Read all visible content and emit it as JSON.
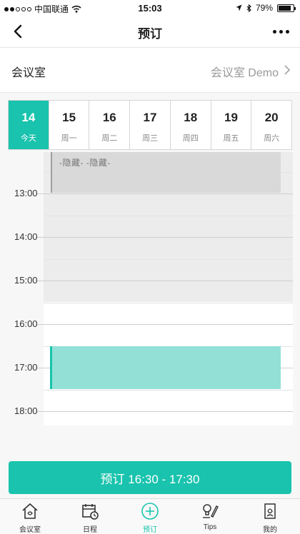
{
  "status_bar": {
    "carrier": "中国联通",
    "time": "15:03",
    "battery": "79%"
  },
  "nav": {
    "title": "预订"
  },
  "room": {
    "label": "会议室",
    "value": "会议室 Demo"
  },
  "dates": [
    {
      "num": "14",
      "weekday": "今天",
      "active": true
    },
    {
      "num": "15",
      "weekday": "周一"
    },
    {
      "num": "16",
      "weekday": "周二"
    },
    {
      "num": "17",
      "weekday": "周三"
    },
    {
      "num": "18",
      "weekday": "周四"
    },
    {
      "num": "19",
      "weekday": "周五"
    },
    {
      "num": "20",
      "weekday": "周六"
    }
  ],
  "schedule": {
    "times": [
      "13:00",
      "14:00",
      "15:00",
      "16:00",
      "17:00",
      "18:00"
    ],
    "hidden_event_label": "-隐藏- -隐藏-"
  },
  "book_button": {
    "label": "预订 16:30 - 17:30"
  },
  "tabs": [
    {
      "label": "会议室",
      "icon": "house-icon"
    },
    {
      "label": "日程",
      "icon": "calendar-icon"
    },
    {
      "label": "预订",
      "icon": "plus-circle-icon",
      "active": true
    },
    {
      "label": "Tips",
      "icon": "tips-icon"
    },
    {
      "label": "我的",
      "icon": "profile-icon"
    }
  ],
  "colors": {
    "accent": "#19c3ad",
    "selection": "#92e0d6"
  }
}
